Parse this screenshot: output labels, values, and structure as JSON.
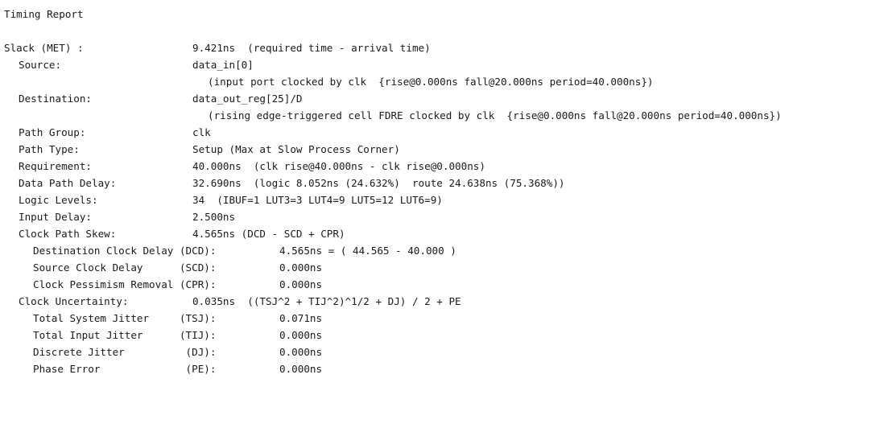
{
  "title": "Timing Report",
  "rows": [
    {
      "label": "Slack (MET) :",
      "value": "9.421ns  (required time - arrival time)"
    },
    {
      "label": "Source:",
      "value": "data_in[0]"
    },
    {
      "label": "",
      "value": "(input port clocked by clk  {rise@0.000ns fall@20.000ns period=40.000ns})"
    },
    {
      "label": "Destination:",
      "value": "data_out_reg[25]/D"
    },
    {
      "label": "",
      "value": "(rising edge-triggered cell FDRE clocked by clk  {rise@0.000ns fall@20.000ns period=40.000ns})"
    },
    {
      "label": "Path Group:",
      "value": "clk"
    },
    {
      "label": "Path Type:",
      "value": "Setup (Max at Slow Process Corner)"
    },
    {
      "label": "Requirement:",
      "value": "40.000ns  (clk rise@40.000ns - clk rise@0.000ns)"
    },
    {
      "label": "Data Path Delay:",
      "value": "32.690ns  (logic 8.052ns (24.632%)  route 24.638ns (75.368%))"
    },
    {
      "label": "Logic Levels:",
      "value": "34  (IBUF=1 LUT3=3 LUT4=9 LUT5=12 LUT6=9)"
    },
    {
      "label": "Input Delay:",
      "value": "2.500ns"
    },
    {
      "label": "Clock Path Skew:",
      "value": "4.565ns (DCD - SCD + CPR)"
    },
    {
      "label": "Destination Clock Delay (DCD):",
      "value": "4.565ns = ( 44.565 - 40.000 )"
    },
    {
      "label": "Source Clock Delay      (SCD):",
      "value": "0.000ns"
    },
    {
      "label": "Clock Pessimism Removal (CPR):",
      "value": "0.000ns"
    },
    {
      "label": "Clock Uncertainty:",
      "value": "0.035ns  ((TSJ^2 + TIJ^2)^1/2 + DJ) / 2 + PE"
    },
    {
      "label": "Total System Jitter     (TSJ):",
      "value": "0.071ns"
    },
    {
      "label": "Total Input Jitter      (TIJ):",
      "value": "0.000ns"
    },
    {
      "label": "Discrete Jitter          (DJ):",
      "value": "0.000ns"
    },
    {
      "label": "Phase Error              (PE):",
      "value": "0.000ns"
    }
  ]
}
